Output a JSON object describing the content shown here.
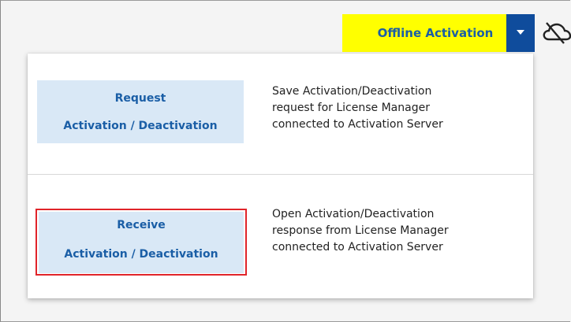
{
  "header": {
    "offline_button_label": "Offline Activation",
    "dropdown_icon": "caret-down-icon",
    "cloud_icon": "cloud-off-icon"
  },
  "menu": {
    "items": [
      {
        "button_line1": "Request",
        "button_line2": "Activation / Deactivation",
        "description": "Save Activation/Deactivation\nrequest for License Manager\nconnected to Activation Server"
      },
      {
        "button_line1": "Receive",
        "button_line2": "Activation / Deactivation",
        "description": "Open Activation/Deactivation\nresponse from License Manager\nconnected to Activation Server",
        "highlighted": true
      }
    ]
  },
  "colors": {
    "offline_button_bg": "#ffff00",
    "offline_button_text": "#1a5ea6",
    "dropdown_bg": "#0f4c9c",
    "action_button_bg": "#d9e8f6",
    "highlight_border": "#e0242a"
  }
}
